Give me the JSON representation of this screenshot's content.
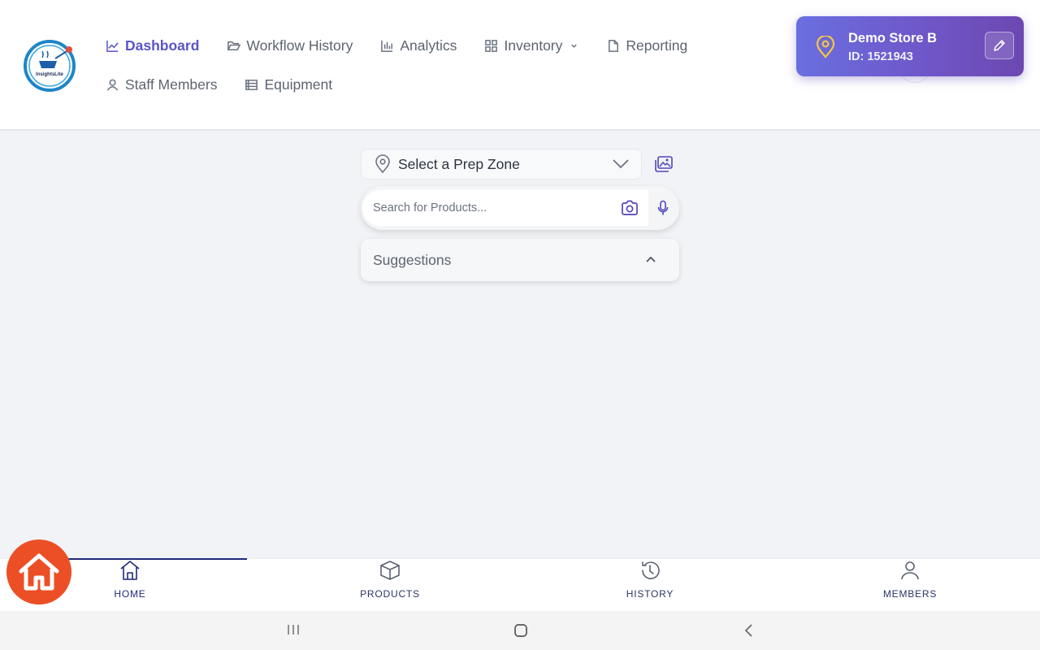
{
  "app": {
    "logo_text": "InsightsLite"
  },
  "nav": {
    "items": [
      {
        "label": "Dashboard",
        "icon": "chart-line-icon",
        "active": true
      },
      {
        "label": "Workflow History",
        "icon": "folder-open-icon"
      },
      {
        "label": "Analytics",
        "icon": "bar-chart-icon"
      },
      {
        "label": "Inventory",
        "icon": "grid-icon",
        "has_dropdown": true
      },
      {
        "label": "Reporting",
        "icon": "document-icon"
      },
      {
        "label": "Staff Members",
        "icon": "user-icon"
      },
      {
        "label": "Equipment",
        "icon": "list-icon"
      }
    ]
  },
  "store": {
    "name": "Demo Store B",
    "id_text": "ID: 1521943",
    "icon": "location-pin-icon",
    "edit_icon": "pencil-icon"
  },
  "zone_select": {
    "label": "Select a Prep Zone",
    "icon": "location-pin-icon"
  },
  "search": {
    "placeholder": "Search for Products...",
    "value": ""
  },
  "suggestions": {
    "label": "Suggestions",
    "expanded": true
  },
  "tabbar": {
    "tabs": [
      {
        "label": "HOME",
        "icon": "home-icon",
        "active": true
      },
      {
        "label": "PRODUCTS",
        "icon": "box-icon"
      },
      {
        "label": "HISTORY",
        "icon": "history-icon"
      },
      {
        "label": "MEMBERS",
        "icon": "person-icon"
      }
    ]
  },
  "colors": {
    "accent": "#5a55c8",
    "store_card_start": "#6a6fe0",
    "store_card_end": "#6c48b1",
    "pin_yellow": "#f5c542",
    "tab_active": "#1f2a7a",
    "fab": "#ec4f26",
    "background": "#f2f3f6"
  }
}
